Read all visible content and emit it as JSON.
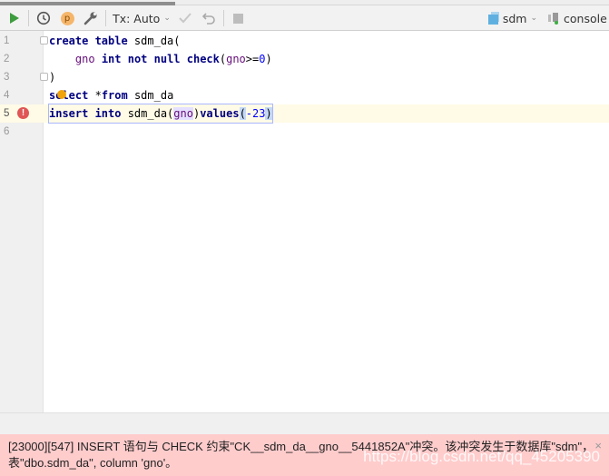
{
  "toolbar": {
    "run_icon": "play-icon",
    "history_icon": "clock-icon",
    "profile_label": "p",
    "settings_icon": "wrench-icon",
    "tx_label": "Tx: Auto",
    "commit_icon": "check-icon",
    "rollback_icon": "undo-icon",
    "stop_icon": "stop-icon",
    "datasource_label": "sdm",
    "console_label": "console"
  },
  "editor": {
    "line_numbers": [
      "1",
      "2",
      "3",
      "4",
      "5",
      "6"
    ],
    "lines": [
      [
        {
          "t": "create table",
          "c": "kw"
        },
        {
          "t": " sdm_da(",
          "c": ""
        }
      ],
      [
        {
          "t": "    ",
          "c": ""
        },
        {
          "t": "gno",
          "c": "col"
        },
        {
          "t": " ",
          "c": ""
        },
        {
          "t": "int not null check",
          "c": "kw"
        },
        {
          "t": "(",
          "c": ""
        },
        {
          "t": "gno",
          "c": "col"
        },
        {
          "t": ">=",
          "c": ""
        },
        {
          "t": "0",
          "c": "num"
        },
        {
          "t": ")",
          "c": ""
        }
      ],
      [
        {
          "t": ")",
          "c": ""
        }
      ],
      [
        {
          "t": "select",
          "c": "kw"
        },
        {
          "t": " *",
          "c": ""
        },
        {
          "t": "from",
          "c": "kw"
        },
        {
          "t": " sdm_da",
          "c": ""
        }
      ],
      [
        {
          "t": "insert into",
          "c": "kw"
        },
        {
          "t": " sdm_da(",
          "c": ""
        },
        {
          "t": "gno",
          "c": "col hl"
        },
        {
          "t": ")",
          "c": ""
        },
        {
          "t": "values",
          "c": "kw"
        },
        {
          "t": "(",
          "c": "hl2"
        },
        {
          "t": "-23",
          "c": "num"
        },
        {
          "t": ")",
          "c": "hl2"
        }
      ],
      []
    ],
    "error_line": "5"
  },
  "error": {
    "message": "[23000][547] INSERT 语句与 CHECK 约束\"CK__sdm_da__gno__5441852A\"冲突。该冲突发生于数据库\"sdm\"，表\"dbo.sdm_da\", column 'gno'。",
    "close_label": "×",
    "watermark": "https://blog.csdn.net/qq_45205390"
  },
  "colors": {
    "run": "#3d9c3d",
    "error_bg": "#ffcccc",
    "error_icon": "#e05555",
    "keyword": "#000080",
    "column": "#660e7a",
    "number": "#0000ff"
  }
}
